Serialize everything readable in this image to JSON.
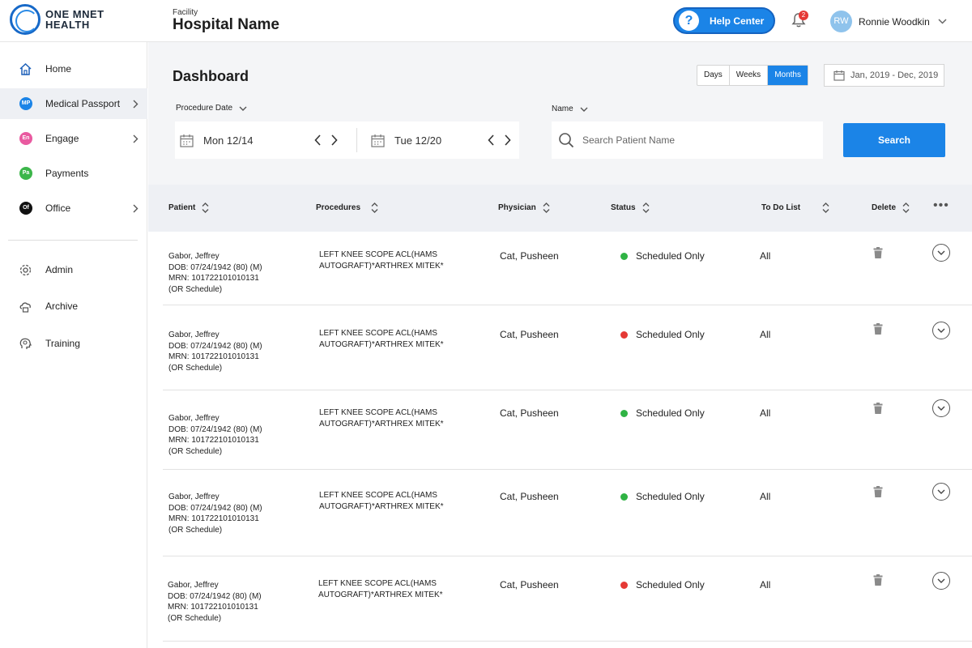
{
  "brand": {
    "line1": "ONE MNET",
    "line2": "HEALTH"
  },
  "facility": {
    "label": "Facility",
    "name": "Hospital Name"
  },
  "header": {
    "help_label": "Help Center",
    "help_glyph": "?",
    "notification_count": "2",
    "user_initials": "RW",
    "user_name": "Ronnie Woodkin"
  },
  "sidebar": {
    "items": [
      {
        "label": "Home",
        "icon": "home-icon"
      },
      {
        "label": "Medical Passport",
        "badge": "MP",
        "badge_color": "#1b84e7"
      },
      {
        "label": "Engage",
        "badge": "En",
        "badge_color": "#e95aa0"
      },
      {
        "label": "Payments",
        "badge": "Pa",
        "badge_color": "#3cb64a"
      },
      {
        "label": "Office",
        "badge": "Of",
        "badge_color": "#111111"
      },
      {
        "label": "Admin",
        "icon": "gear-icon"
      },
      {
        "label": "Archive",
        "icon": "archive-icon"
      },
      {
        "label": "Training",
        "icon": "brain-icon"
      }
    ]
  },
  "dashboard": {
    "title": "Dashboard",
    "range_tabs": [
      "Days",
      "Weeks",
      "Months"
    ],
    "active_tab": "Months",
    "date_range": "Jan, 2019 - Dec, 2019",
    "procedure_date_label": "Procedure Date",
    "start_date": "Mon 12/14",
    "end_date": "Tue 12/20",
    "name_label": "Name",
    "search_placeholder": "Search Patient Name",
    "search_button": "Search"
  },
  "table": {
    "headers": {
      "patient": "Patient",
      "procedures": "Procedures",
      "physician": "Physician",
      "status": "Status",
      "todo": "To Do List",
      "delete": "Delete",
      "more": "•••"
    },
    "rows": [
      {
        "name": "Gabor, Jeffrey",
        "dob": "DOB: 07/24/1942 (80) (M)",
        "mrn": "MRN: 101722101010131",
        "schedule": "(OR Schedule)",
        "proc1": "LEFT KNEE SCOPE ACL(HAMS",
        "proc2": "AUTOGRAFT)*ARTHREX MITEK*",
        "physician": "Cat, Pusheen",
        "status": "Scheduled Only",
        "status_color": "#2fb344",
        "todo": "All"
      },
      {
        "name": "Gabor, Jeffrey",
        "dob": "DOB: 07/24/1942 (80) (M)",
        "mrn": "MRN: 101722101010131",
        "schedule": "(OR Schedule)",
        "proc1": "LEFT KNEE SCOPE ACL(HAMS",
        "proc2": "AUTOGRAFT)*ARTHREX MITEK*",
        "physician": "Cat, Pusheen",
        "status": "Scheduled Only",
        "status_color": "#e53935",
        "todo": "All"
      },
      {
        "name": "Gabor, Jeffrey",
        "dob": "DOB: 07/24/1942 (80) (M)",
        "mrn": "MRN: 101722101010131",
        "schedule": "(OR Schedule)",
        "proc1": "LEFT KNEE SCOPE ACL(HAMS",
        "proc2": "AUTOGRAFT)*ARTHREX MITEK*",
        "physician": "Cat, Pusheen",
        "status": "Scheduled Only",
        "status_color": "#2fb344",
        "todo": "All"
      },
      {
        "name": "Gabor, Jeffrey",
        "dob": "DOB: 07/24/1942 (80) (M)",
        "mrn": "MRN: 101722101010131",
        "schedule": "(OR Schedule)",
        "proc1": "LEFT KNEE SCOPE ACL(HAMS",
        "proc2": "AUTOGRAFT)*ARTHREX MITEK*",
        "physician": "Cat, Pusheen",
        "status": "Scheduled Only",
        "status_color": "#2fb344",
        "todo": "All"
      },
      {
        "name": "Gabor, Jeffrey",
        "dob": "DOB: 07/24/1942 (80) (M)",
        "mrn": "MRN: 101722101010131",
        "schedule": "(OR Schedule)",
        "proc1": "LEFT KNEE SCOPE ACL(HAMS",
        "proc2": "AUTOGRAFT)*ARTHREX MITEK*",
        "physician": "Cat, Pusheen",
        "status": "Scheduled Only",
        "status_color": "#e53935",
        "todo": "All"
      }
    ]
  }
}
